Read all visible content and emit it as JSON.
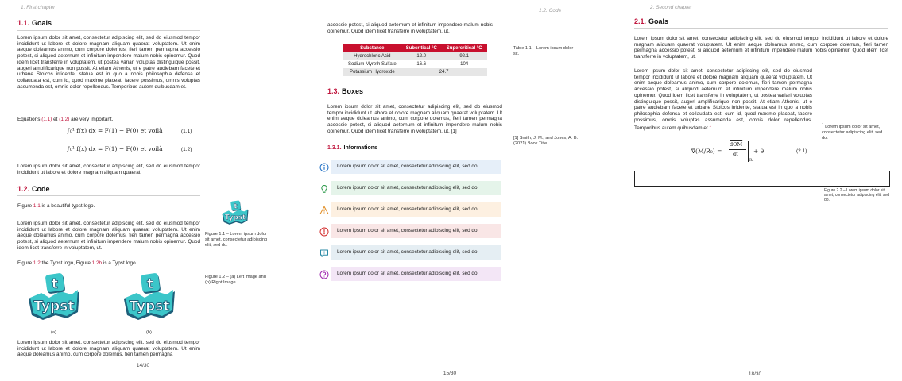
{
  "pages": [
    {
      "header": "1. First chapter",
      "page_number": "14/30",
      "goals": {
        "num": "1.1.",
        "title": "Goals",
        "para1": "Lorem ipsum dolor sit amet, consectetur adipiscing elit, sed do eiusmod tempor incididunt ut labore et dolore magnam aliquam quaerat voluptatem. Ut enim aeque doleamus animo, cum corpore dolemus, fieri tamen permagna accessio potest, si aliquod aeternum et infinitum impendere malum nobis opinemur. Quod idem licet transferre in voluptatem, ut postea variari voluptas distinguique possit, augeri amplificarique non possit. At etiam Athenis, ut e patre audiebam facete et urbane Stoicos irridente, statua est in quo a nobis philosophia defensa et collaudata est, cum id, quod maxime placeat, facere possimus, omnis voluptas assumenda est, omnis dolor repellendus. Temporibus autem quibusdam et.",
        "eq_intro_pre": "Equations ",
        "eq_ref1": "(1.1)",
        "eq_intro_mid": " et ",
        "eq_ref2": "(1.2)",
        "eq_intro_post": " are very important.",
        "eq1": "∫₀¹ f(x) dx = F(1) − F(0) et voilà",
        "eq1_num": "(1.1)",
        "eq2": "∫₀¹ f(x) dx = F(1) − F(0) et voilà",
        "eq2_num": "(1.2)",
        "para2": "Lorem ipsum dolor sit amet, consectetur adipiscing elit, sed do eiusmod tempor incididunt ut labore et dolore magnam aliquam quaerat."
      },
      "code": {
        "num": "1.2.",
        "title": "Code",
        "fig_intro_pre": "Figure ",
        "fig_ref": "1.1",
        "fig_intro_post": " is a beautiful typst logo.",
        "para1": "Lorem ipsum dolor sit amet, consectetur adipiscing elit, sed do eiusmod tempor incididunt ut labore et dolore magnam aliquam quaerat voluptatem. Ut enim aeque doleamus animo, cum corpore dolemus, fieri tamen permagna accessio potest, si aliquod aeternum et infinitum impendere malum nobis opinemur. Quod idem licet transferre in voluptatem, ut.",
        "fig2_pre": "Figure ",
        "fig2_ref": "1.2",
        "fig2_mid": " the Typst logo, Figure ",
        "fig2_ref_b": "1.2b",
        "fig2_post": " is a Typst logo.",
        "sub_a": "(a)",
        "sub_b": "(b)",
        "para2": "Lorem ipsum dolor sit amet, consectetur adipiscing elit, sed do eiusmod tempor incididunt ut labore et dolore magnam aliquam quaerat voluptatem. Ut enim aeque doleamus animo, cum corpore dolemus, fieri tamen permagna",
        "fig11_caption": "Figure 1.1 – Lorem ipsum dolor sit amet, consectetur adipiscing elit, sed do.",
        "fig12_caption": "Figure 1.2 – (a) Left image and (b) Right Image"
      }
    },
    {
      "header": "1.2. Code",
      "page_number": "15/30",
      "intro": "accessio potest, si aliquod aeternum et infinitum impendere malum nobis opinemur. Quod idem licet transferre in voluptatem, ut.",
      "table": {
        "headers": [
          "Substance",
          "Subcritical °C",
          "Supercritical °C"
        ],
        "rows": [
          [
            "Hydrochloric Acid",
            "12.0",
            "92.1"
          ],
          [
            "Sodium Myreth Sulfate",
            "16.6",
            "104"
          ],
          [
            "Potassium Hydroxide",
            "24.7"
          ]
        ],
        "caption": "Table 1.1 – Lorem ipsum dolor sit."
      },
      "boxes": {
        "num": "1.3.",
        "title": "Boxes",
        "para": "Lorem ipsum dolor sit amet, consectetur adipiscing elit, sed do eiusmod tempor incididunt ut labore et dolore magnam aliquam quaerat voluptatem. Ut enim aeque doleamus animo, cum corpore dolemus, fieri tamen permagna accessio potest, si aliquod aeternum et infinitum impendere malum nobis opinemur. Quod idem licet transferre in voluptatem, ut. [1]",
        "citation": "[1]  Smith, J. M., and Jones, A. B. (2021) Book Title",
        "sub_num": "1.3.1.",
        "sub_title": "Informations",
        "items": [
          {
            "text": "Lorem ipsum dolor sit amet, consectetur adipiscing elit, sed do.",
            "icon": "info-icon",
            "color": "#1f6fc4",
            "bg": "#e6eff9"
          },
          {
            "text": "Lorem ipsum dolor sit amet, consectetur adipiscing elit, sed do.",
            "icon": "lightbulb-icon",
            "color": "#2e9a4c",
            "bg": "#e5f4ea"
          },
          {
            "text": "Lorem ipsum dolor sit amet, consectetur adipiscing elit, sed do.",
            "icon": "warning-icon",
            "color": "#e08a1e",
            "bg": "#fdf0e1"
          },
          {
            "text": "Lorem ipsum dolor sit amet, consectetur adipiscing elit, sed do.",
            "icon": "error-icon",
            "color": "#d32a2a",
            "bg": "#f9e6e6"
          },
          {
            "text": "Lorem ipsum dolor sit amet, consectetur adipiscing elit, sed do.",
            "icon": "comment-icon",
            "color": "#2a8aa6",
            "bg": "#e5eef3"
          },
          {
            "text": "Lorem ipsum dolor sit amet, consectetur adipiscing elit, sed do.",
            "icon": "question-icon",
            "color": "#a02ab0",
            "bg": "#f3e6f6"
          }
        ]
      }
    },
    {
      "header": "2. Second chapter",
      "page_number": "18/30",
      "goals": {
        "num": "2.1.",
        "title": "Goals",
        "para1": "Lorem ipsum dolor sit amet, consectetur adipiscing elit, sed do eiusmod tempor incididunt ut labore et dolore magnam aliquam quaerat voluptatem. Ut enim aeque doleamus animo, cum corpore dolemus, fieri tamen permagna accessio potest, si aliquod aeternum et infinitum impendere malum nobis opinemur. Quod idem licet transferre in voluptatem, ut.",
        "para2": "Lorem ipsum dolor sit amet, consectetur adipiscing elit, sed do eiusmod tempor incididunt ut labore et dolore magnam aliquam quaerat voluptatem. Ut enim aeque doleamus animo, cum corpore dolemus, fieri tamen permagna accessio potest, si aliquod aeternum et infinitum impendere malum nobis opinemur. Quod idem licet transferre in voluptatem, ut postea variari voluptas distinguique possit, augeri amplificarique non possit. At etiam Athenis, ut e patre audiebam facete et urbane Stoicos irridente, statua est in quo a nobis philosophia defensa et collaudata est, cum id, quod maxime placeat, facere possimus, omnis voluptas assumenda est, omnis dolor repellendus. Temporibus autem quibusdam et.",
        "footnote_mark": "1",
        "footnote": "Lorem ipsum dolor sit amet, consectetur adipiscing elit, sed do.",
        "eq_lhs": "∇⃗(M/R₀) =",
        "eq_num": "(2.1)",
        "eq_top": "dOM",
        "eq_bot": "dt",
        "eq_sub": "R₀",
        "eq_tail": "+ θ",
        "fig22_caption": "Figure 2.2 – Lorem ipsum dolor sit amet, consectetur adipiscing elit, sed do."
      }
    }
  ],
  "logo": {
    "text_t": "t",
    "text_typst": "Typst",
    "colors": {
      "teal": "#3bc6c9",
      "dark": "#1e5f7a",
      "white": "#ffffff"
    }
  }
}
